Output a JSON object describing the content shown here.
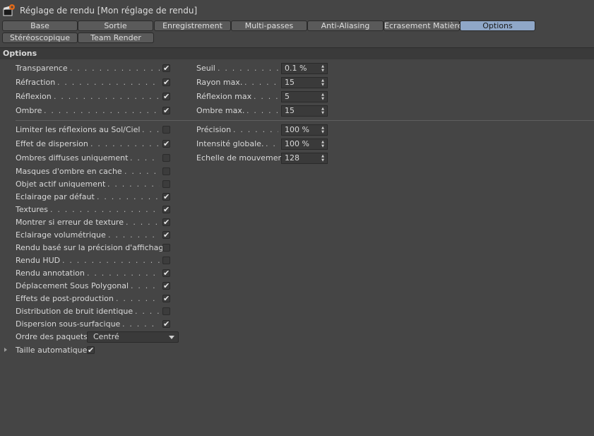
{
  "window": {
    "title": "Réglage de rendu [Mon réglage de rendu]",
    "icon": "clapperboard-gear-icon"
  },
  "tabs": [
    {
      "label": "Base",
      "active": false
    },
    {
      "label": "Sortie",
      "active": false
    },
    {
      "label": "Enregistrement",
      "active": false
    },
    {
      "label": "Multi-passes",
      "active": false
    },
    {
      "label": "Anti-Aliasing",
      "active": false
    },
    {
      "label": "Ecrasement Matière",
      "active": false
    },
    {
      "label": "Options",
      "active": true
    },
    {
      "label": "Stéréoscopique",
      "active": false
    },
    {
      "label": "Team Render",
      "active": false
    }
  ],
  "section": {
    "title": "Options"
  },
  "checkboxes_top": [
    {
      "label": "Transparence",
      "checked": true
    },
    {
      "label": "Réfraction",
      "checked": true
    },
    {
      "label": "Réflexion",
      "checked": true
    },
    {
      "label": "Ombre",
      "checked": true
    }
  ],
  "fields_top": [
    {
      "label": "Seuil",
      "value": "0.1 %"
    },
    {
      "label": "Rayon max.",
      "value": "15"
    },
    {
      "label": "Réflexion max",
      "value": "5"
    },
    {
      "label": "Ombre max.",
      "value": "15"
    }
  ],
  "checkboxes_bottom": [
    {
      "label": "Limiter les réflexions au Sol/Ciel",
      "checked": false
    },
    {
      "label": "Effet de dispersion",
      "checked": true
    },
    {
      "label": "Ombres diffuses uniquement",
      "checked": false
    },
    {
      "label": "Masques d'ombre en cache",
      "checked": false
    },
    {
      "label": "Objet actif uniquement",
      "checked": false
    },
    {
      "label": "Eclairage par défaut",
      "checked": true
    },
    {
      "label": "Textures",
      "checked": true
    },
    {
      "label": "Montrer si erreur de texture",
      "checked": true
    },
    {
      "label": "Eclairage volumétrique",
      "checked": true
    },
    {
      "label": "Rendu basé sur la précision d'affichage",
      "checked": false
    },
    {
      "label": "Rendu HUD",
      "checked": false
    },
    {
      "label": "Rendu annotation",
      "checked": true
    },
    {
      "label": "Déplacement Sous Polygonal",
      "checked": true
    },
    {
      "label": "Effets de post-production",
      "checked": true
    },
    {
      "label": "Distribution de bruit identique",
      "checked": false
    },
    {
      "label": "Dispersion sous-surfacique",
      "checked": true
    }
  ],
  "fields_bottom": [
    {
      "label": "Précision",
      "value": "100 %"
    },
    {
      "label": "Intensité globale.",
      "value": "100 %"
    },
    {
      "label": "Echelle de mouvement",
      "value": "128"
    }
  ],
  "ordre_paquets": {
    "label": "Ordre des paquets",
    "value": "Centré"
  },
  "taille_auto": {
    "label": "Taille automatique",
    "checked": true
  },
  "check_glyph": "✔",
  "spin_glyph": "▲▼"
}
